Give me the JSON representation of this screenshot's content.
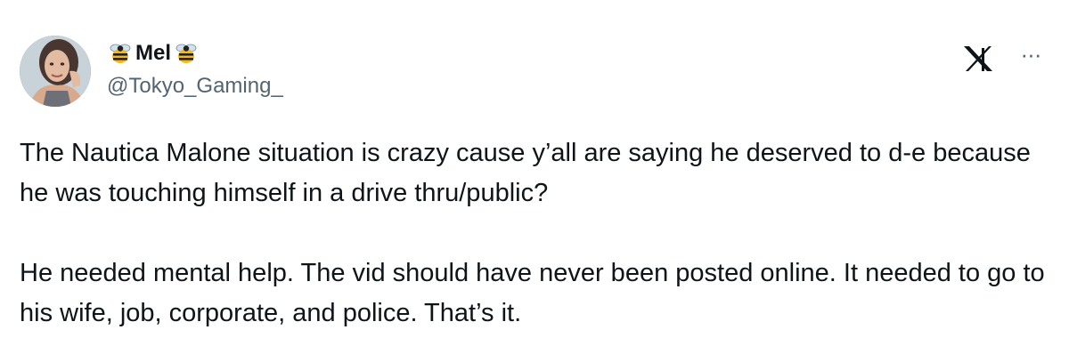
{
  "user": {
    "display_name": "Mel",
    "handle": "@Tokyo_Gaming_",
    "name_emoji_left": "bee-icon",
    "name_emoji_right": "bee-icon"
  },
  "icons": {
    "platform": "x-logo-icon",
    "menu": "more-options-icon"
  },
  "tweet": {
    "paragraphs": [
      "The Nautica Malone situation is crazy cause y’all are saying he deserved to d-e because he was touching himself in a drive thru/public?",
      "He needed mental help. The vid should have never been posted online. It needed to go to his wife, job, corporate, and police. That’s it."
    ]
  },
  "colors": {
    "text_primary": "#0f1419",
    "text_secondary": "#536471",
    "background": "#ffffff"
  }
}
